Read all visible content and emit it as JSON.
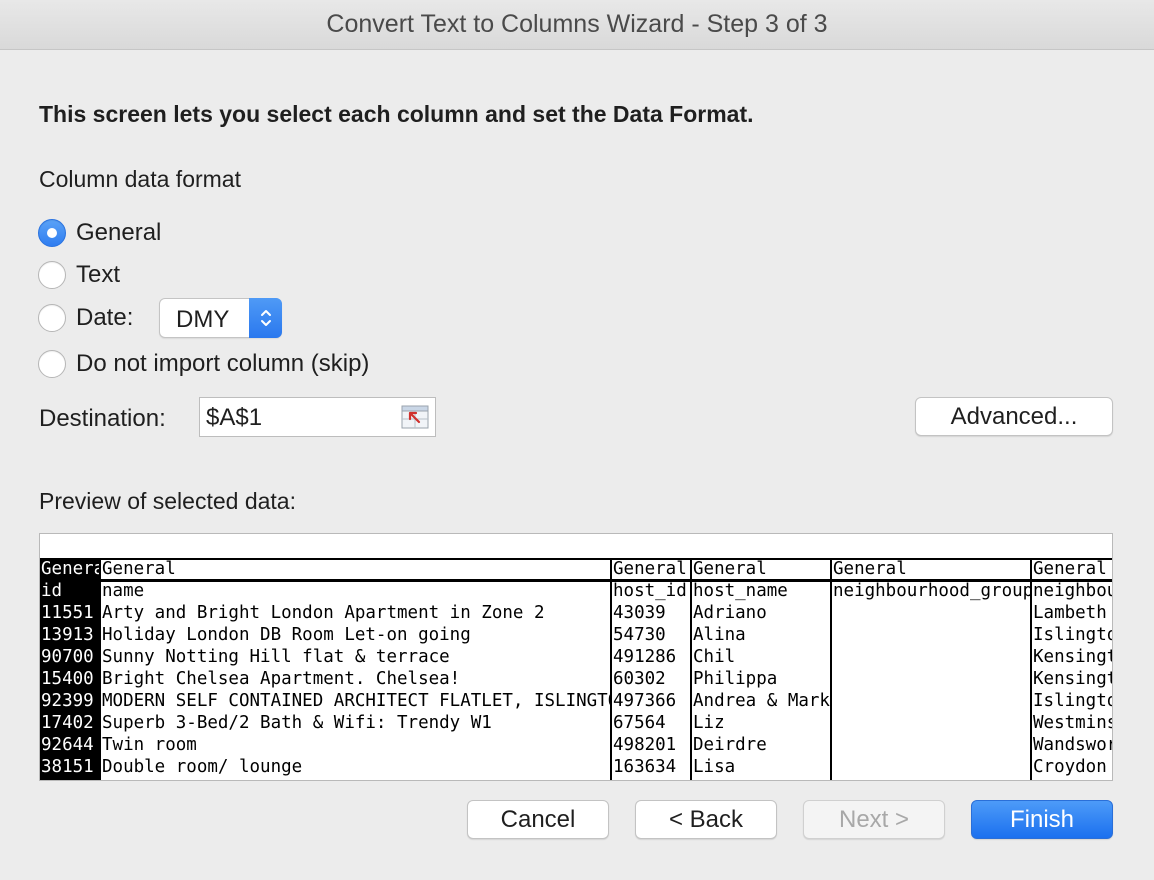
{
  "window": {
    "title": "Convert Text to Columns Wizard - Step 3 of 3"
  },
  "instructions": "This screen lets you select each column and set the Data Format.",
  "column_format": {
    "heading": "Column data format",
    "options": [
      {
        "label": "General",
        "checked": true
      },
      {
        "label": "Text",
        "checked": false
      },
      {
        "label": "Date:",
        "checked": false
      },
      {
        "label": "Do not import column (skip)",
        "checked": false
      }
    ],
    "date_format": "DMY"
  },
  "destination": {
    "label": "Destination:",
    "value": "$A$1"
  },
  "advanced_button": "Advanced...",
  "preview": {
    "label": "Preview of selected data:",
    "columns": [
      {
        "format": "General",
        "cells": [
          "id",
          "11551",
          "13913",
          "90700",
          "15400",
          "92399",
          "17402",
          "92644",
          "38151"
        ]
      },
      {
        "format": "General",
        "cells": [
          "name",
          "Arty and Bright London Apartment in Zone 2",
          "Holiday London DB Room Let-on going",
          "Sunny Notting Hill flat & terrace",
          "Bright Chelsea  Apartment. Chelsea!",
          "MODERN SELF CONTAINED ARCHITECT FLATLET, ISLINGTON",
          "Superb 3-Bed/2 Bath & Wifi: Trendy W1",
          "Twin room",
          "Double room/ lounge"
        ]
      },
      {
        "format": "General",
        "cells": [
          "host_id",
          "43039",
          "54730",
          "491286",
          "60302",
          "497366",
          "67564",
          "498201",
          "163634"
        ]
      },
      {
        "format": "General",
        "cells": [
          "host_name",
          "Adriano",
          "Alina",
          "Chil",
          "Philippa",
          "Andrea & Mark",
          "Liz",
          "Deirdre",
          "Lisa"
        ]
      },
      {
        "format": "General",
        "cells": [
          "neighbourhood_group",
          "",
          "",
          "",
          "",
          "",
          "",
          "",
          ""
        ]
      },
      {
        "format": "General",
        "cells": [
          "neighbourhood",
          "Lambeth",
          "Islington",
          "Kensington and Chelsea",
          "Kensington and Chelsea",
          "Islington",
          "Westminster",
          "Wandsworth",
          "Croydon"
        ]
      }
    ]
  },
  "buttons": {
    "cancel": "Cancel",
    "back": "< Back",
    "next": "Next >",
    "finish": "Finish"
  },
  "colors": {
    "accent": "#2f7df0",
    "primary_button": "#1b70ef"
  }
}
